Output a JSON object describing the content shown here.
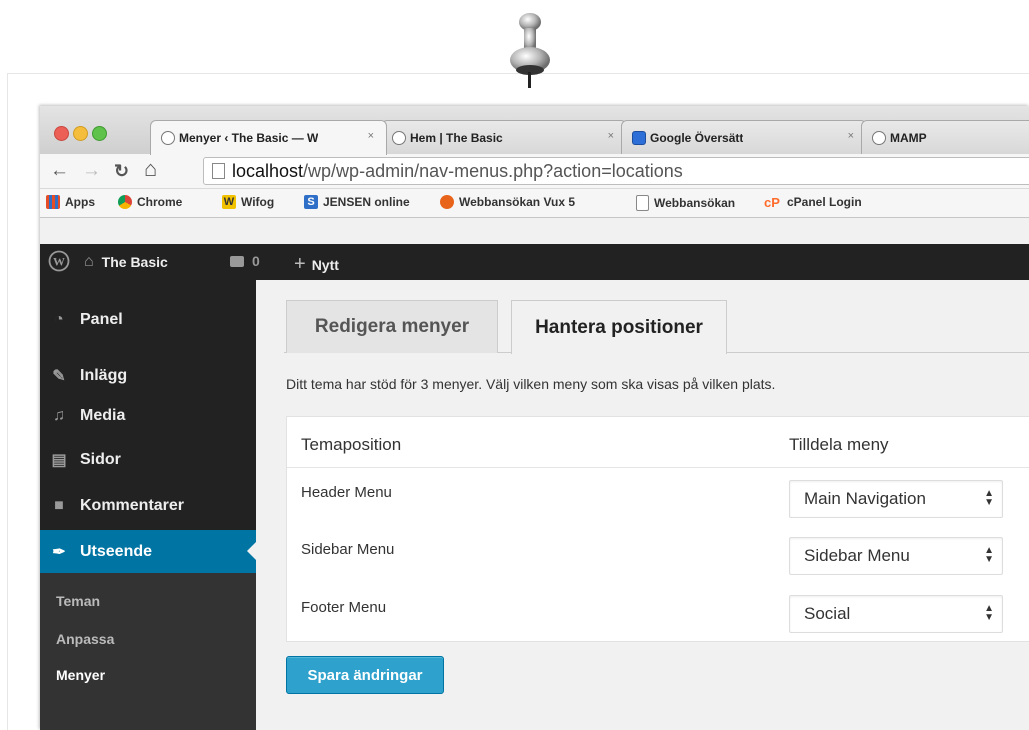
{
  "browser": {
    "tabs": [
      {
        "label": "Menyer ‹ The Basic — W",
        "close": "×",
        "active": true
      },
      {
        "label": "Hem | The Basic",
        "close": "×",
        "active": false
      },
      {
        "label": "Google Översätt",
        "close": "×",
        "active": false
      },
      {
        "label": "MAMP",
        "close": "×",
        "active": false
      }
    ],
    "url_host": "localhost",
    "url_path": "/wp/wp-admin/nav-menus.php?action=locations",
    "bookmarks": [
      {
        "label": "Apps",
        "color": "#e44d26"
      },
      {
        "label": "Chrome",
        "color": "#db4437"
      },
      {
        "label": "Wifog",
        "color": "#f2c200"
      },
      {
        "label": "JENSEN online",
        "color": "#2f6fc7"
      },
      {
        "label": "Webbansökan Vux 5",
        "color": "#e8641b"
      },
      {
        "label": "Webbansökan",
        "color": "#ffffff"
      },
      {
        "label": "cPanel Login",
        "color": "#ff6c2c"
      }
    ]
  },
  "adminbar": {
    "site_name": "The Basic",
    "comments_count": "0",
    "new_label": "Nytt"
  },
  "sidebar": {
    "items": [
      {
        "label": "Panel",
        "icon": "dashboard-icon"
      },
      {
        "label": "Inlägg",
        "icon": "pin-icon"
      },
      {
        "label": "Media",
        "icon": "media-icon"
      },
      {
        "label": "Sidor",
        "icon": "pages-icon"
      },
      {
        "label": "Kommentarer",
        "icon": "comments-icon"
      },
      {
        "label": "Utseende",
        "icon": "appearance-icon",
        "current": true
      }
    ],
    "submenu": [
      "Teman",
      "Anpassa",
      "Menyer"
    ]
  },
  "main": {
    "tabs": [
      "Redigera menyer",
      "Hantera positioner"
    ],
    "info": "Ditt tema har stöd för 3 menyer. Välj vilken meny som ska visas på vilken plats.",
    "columns": [
      "Temaposition",
      "Tilldela meny"
    ],
    "rows": [
      {
        "position": "Header Menu",
        "menu": "Main Navigation"
      },
      {
        "position": "Sidebar Menu",
        "menu": "Sidebar Menu"
      },
      {
        "position": "Footer Menu",
        "menu": "Social"
      }
    ],
    "save_label": "Spara ändringar"
  },
  "colors": {
    "admin_dark": "#222222",
    "accent": "#0074a2",
    "button": "#2ea2cc"
  }
}
